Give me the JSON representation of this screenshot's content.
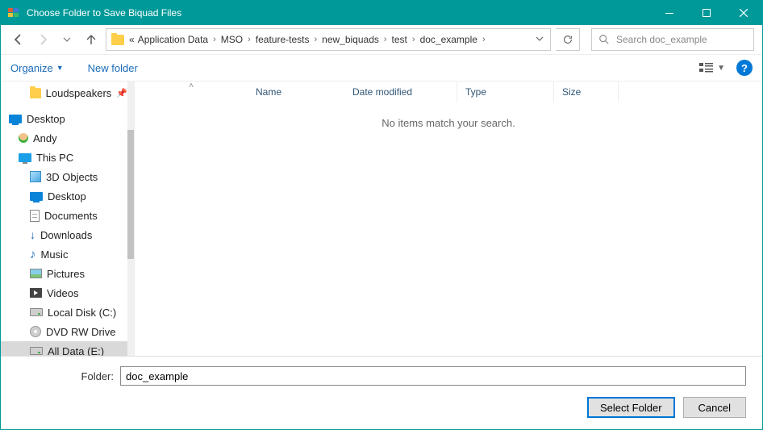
{
  "window": {
    "title": "Choose Folder to Save Biquad Files"
  },
  "breadcrumb": {
    "prefix": "«",
    "items": [
      "Application Data",
      "MSO",
      "feature-tests",
      "new_biquads",
      "test",
      "doc_example"
    ]
  },
  "search": {
    "placeholder": "Search doc_example"
  },
  "cmd": {
    "organize": "Organize",
    "newfolder": "New folder"
  },
  "columns": {
    "name": "Name",
    "date": "Date modified",
    "type": "Type",
    "size": "Size"
  },
  "empty_msg": "No items match your search.",
  "tree": {
    "loudspeakers": "Loudspeakers",
    "desktop": "Desktop",
    "user": "Andy",
    "thispc": "This PC",
    "objects3d": "3D Objects",
    "desktop2": "Desktop",
    "documents": "Documents",
    "downloads": "Downloads",
    "music": "Music",
    "pictures": "Pictures",
    "videos": "Videos",
    "local": "Local Disk (C:)",
    "dvd": "DVD RW Drive",
    "alldata": "All Data (E:)"
  },
  "footer": {
    "folder_label": "Folder:",
    "folder_value": "doc_example",
    "select_btn": "Select Folder",
    "cancel_btn": "Cancel"
  }
}
